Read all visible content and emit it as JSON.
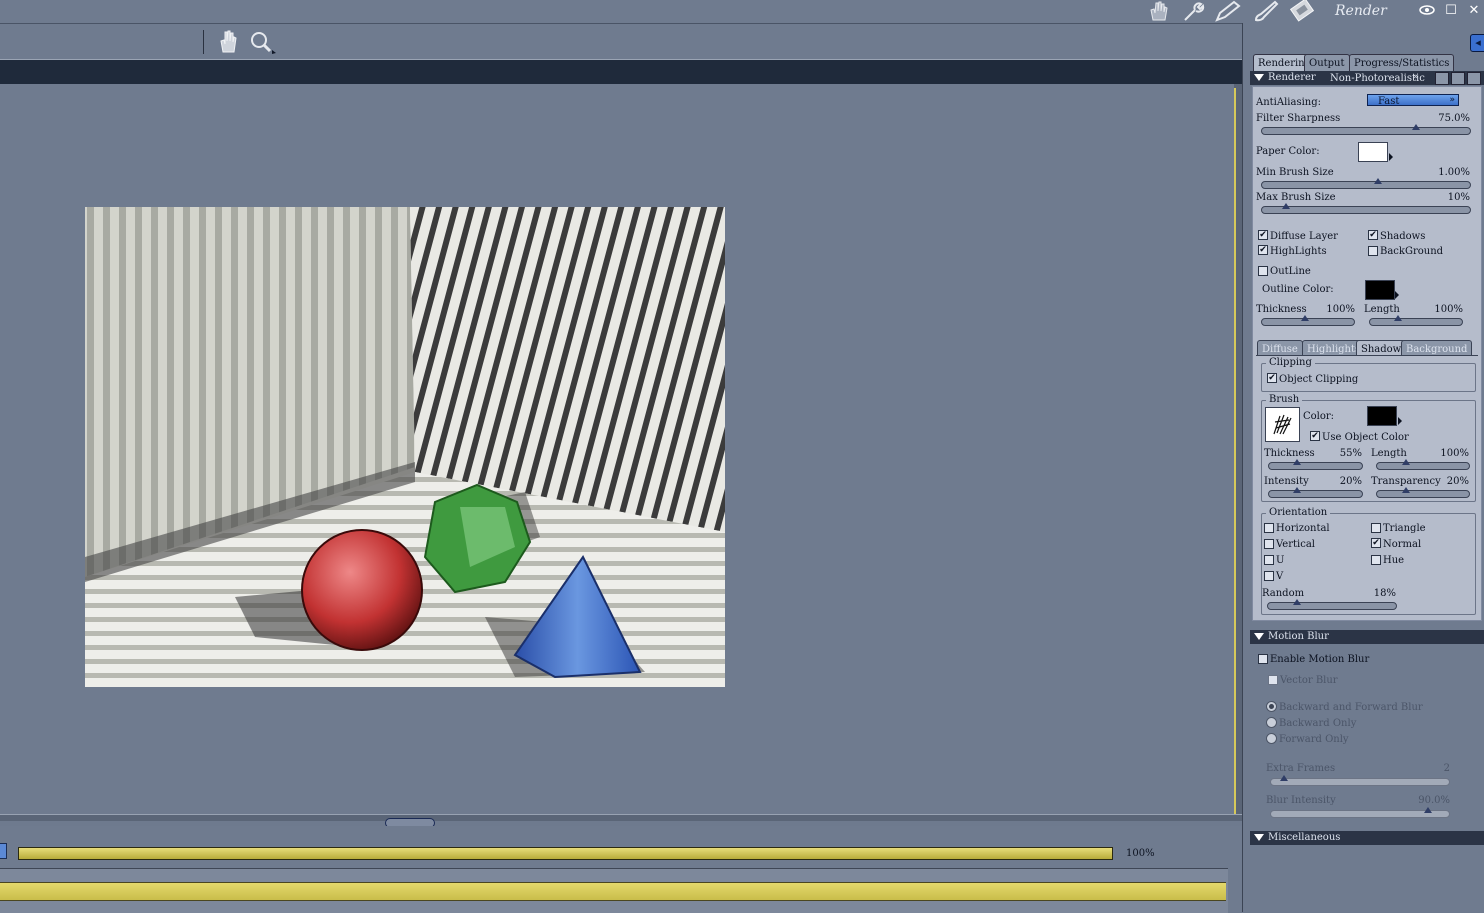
{
  "top_bar": {
    "room_label": "Render",
    "room_icons": [
      "hand-room-icon",
      "wrench-room-icon",
      "pen-room-icon",
      "brush-room-icon",
      "film-room-icon"
    ],
    "window_controls": [
      "eye-icon",
      "maximize-icon",
      "close-icon"
    ],
    "maximize_glyph": "☐",
    "close_glyph": "✕"
  },
  "toolbar": {
    "tools": [
      "hand-icon",
      "zoom-icon"
    ]
  },
  "progress": {
    "percent_label": "100%",
    "progress_value": 1.0
  },
  "panel": {
    "collapse_glyph": "◂",
    "tabs": [
      "Rendering",
      "Output",
      "Progress/Statistics"
    ],
    "active_tab": "Rendering",
    "renderer_header": "Renderer",
    "renderer_value": "Non-Photorealistic",
    "antialiasing_label": "AntiAliasing:",
    "antialiasing_value": "Fast",
    "filter_sharpness_label": "Filter Sharpness",
    "filter_sharpness_value": "75.0%",
    "paper_color_label": "Paper Color:",
    "min_brush_label": "Min Brush Size",
    "min_brush_value": "1.00%",
    "max_brush_label": "Max Brush Size",
    "max_brush_value": "10%",
    "diffuse_layer": "Diffuse Layer",
    "shadows": "Shadows",
    "highlights": "HighLights",
    "background": "BackGround",
    "outline": "OutLine",
    "outline_color_label": "Outline Color:",
    "thickness_label": "Thickness",
    "thickness_value": "100%",
    "length_label": "Length",
    "length_value": "100%",
    "subtabs": [
      "Diffuse",
      "Highlights",
      "Shadow",
      "Background"
    ],
    "active_subtab": "Shadow",
    "clipping_title": "Clipping",
    "object_clipping": "Object Clipping",
    "brush_title": "Brush",
    "brush_color_label": "Color:",
    "use_object_color": "Use Object Color",
    "brush_thickness_label": "Thickness",
    "brush_thickness_value": "55%",
    "brush_length_label": "Length",
    "brush_length_value": "100%",
    "intensity_label": "Intensity",
    "intensity_value": "20%",
    "transparency_label": "Transparency",
    "transparency_value": "20%",
    "orientation_title": "Orientation",
    "horizontal": "Horizontal",
    "triangle": "Triangle",
    "vertical": "Vertical",
    "normal": "Normal",
    "u": "U",
    "hue": "Hue",
    "v": "V",
    "random_label": "Random",
    "random_value": "18%",
    "motion_blur_header": "Motion Blur",
    "enable_motion_blur": "Enable Motion Blur",
    "vector_blur": "Vector Blur",
    "backward_forward": "Backward and Forward Blur",
    "backward_only": "Backward Only",
    "forward_only": "Forward Only",
    "extra_frames_label": "Extra Frames",
    "extra_frames_value": "2",
    "blur_intensity_label": "Blur Intensity",
    "blur_intensity_value": "90.0%",
    "misc_header": "Miscellaneous",
    "checkbox_glyph": "✔"
  },
  "slider_levels": {
    "filter_sharpness": 0.75,
    "min_brush": 0.56,
    "max_brush": 0.1,
    "outline_thickness": 0.47,
    "outline_length": 0.28,
    "brush_thickness": 0.28,
    "brush_length": 0.3,
    "intensity": 0.28,
    "transparency": 0.3,
    "random": 0.21,
    "extra_frames": 0.05,
    "blur_intensity": 0.9
  },
  "colors": {
    "paper_color": "#ffffff",
    "outline_color": "#000000",
    "brush_color": "#000000",
    "progress_yellow": "#d8cc5c",
    "select_blue": "#4f86da"
  }
}
